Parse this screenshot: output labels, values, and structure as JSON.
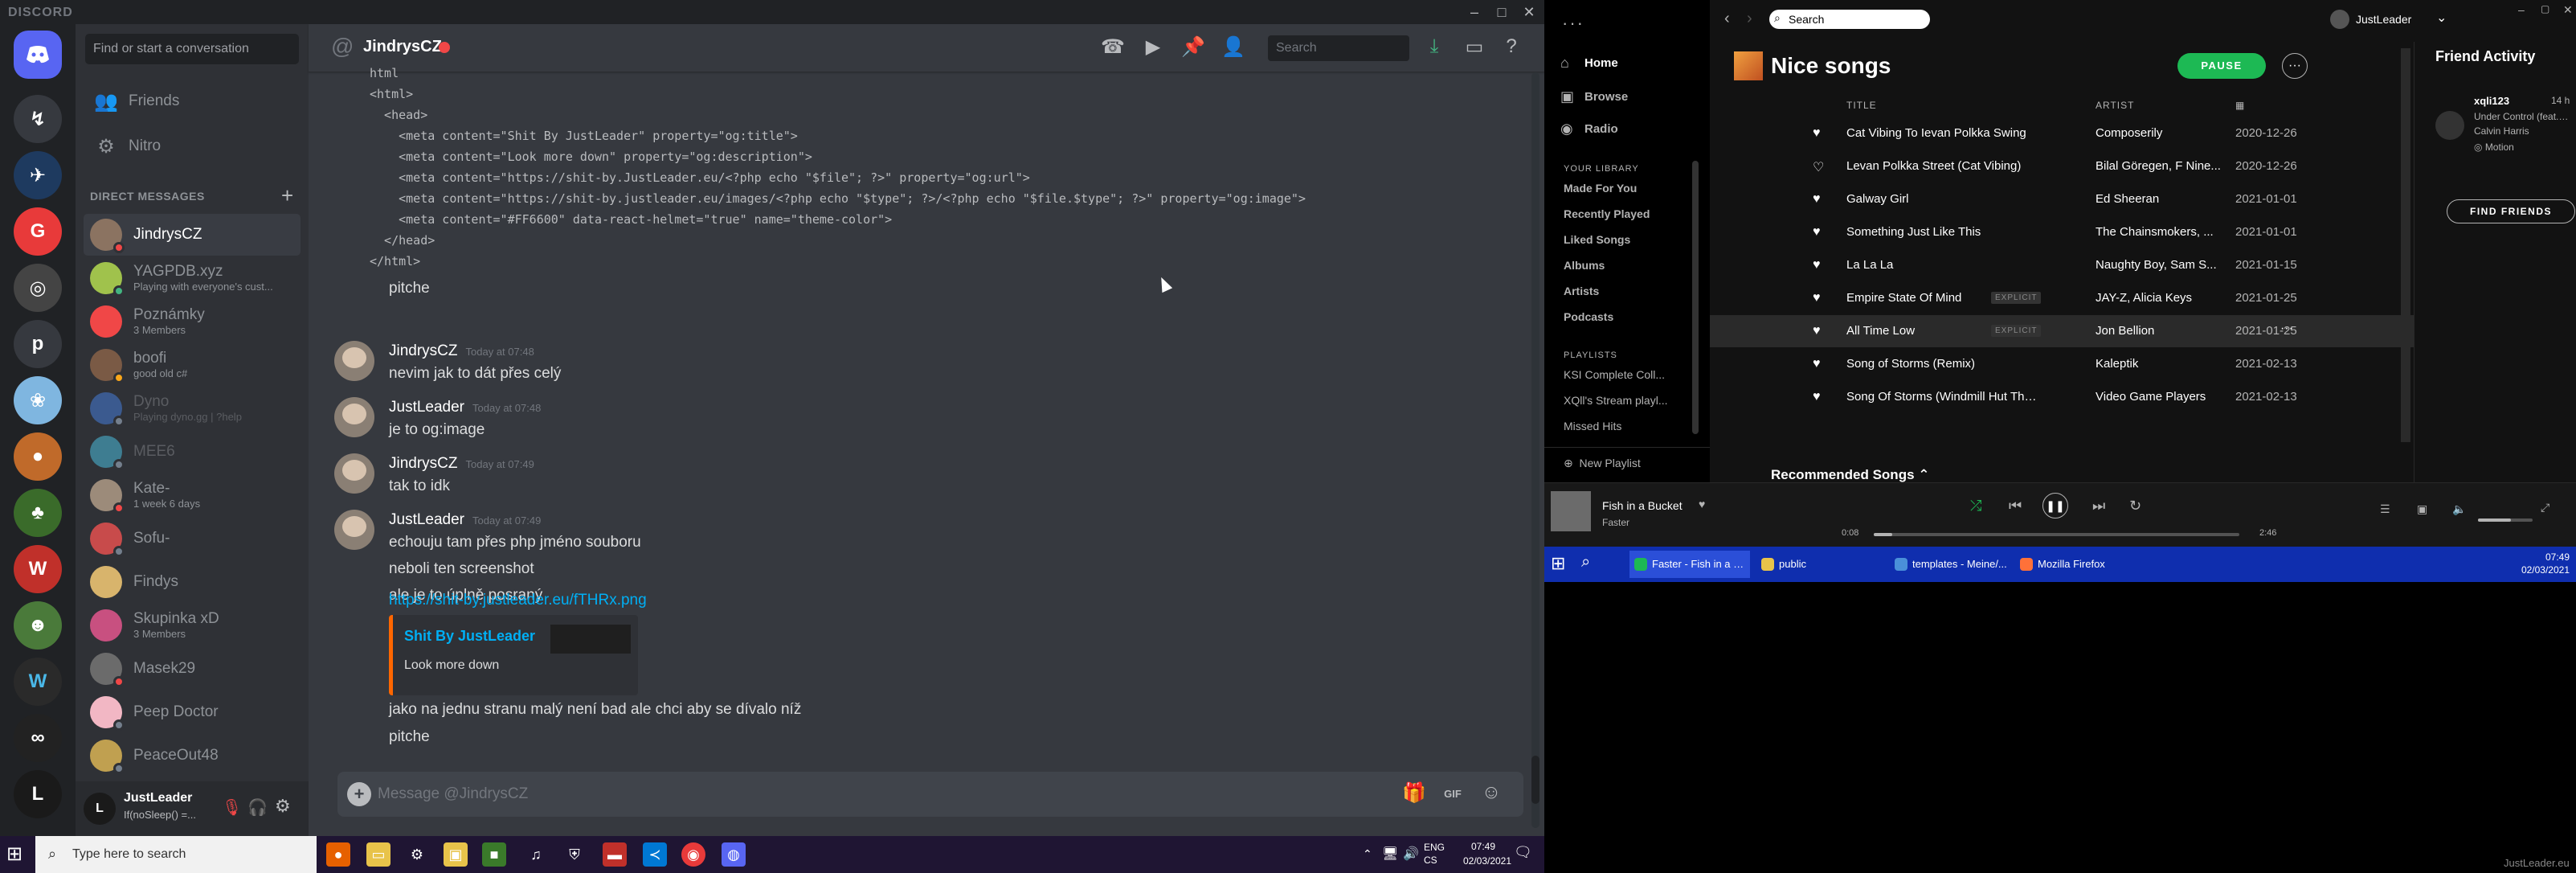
{
  "discord": {
    "brand": "DISCORD",
    "search_placeholder": "Find or start a conversation",
    "nav": {
      "friends": "Friends",
      "nitro": "Nitro"
    },
    "dm_header": "DIRECT MESSAGES",
    "dms": [
      {
        "name": "JindrysCZ",
        "sub": "",
        "color": "#8b7361",
        "status": "#f04747",
        "active": true
      },
      {
        "name": "YAGPDB.xyz",
        "sub": "Playing with everyone's cust...",
        "color": "#a0c24c",
        "status": "#43b581",
        "active": false
      },
      {
        "name": "Poznámky",
        "sub": "3 Members",
        "color": "#f04747",
        "status": "",
        "active": false
      },
      {
        "name": "boofi",
        "sub": "good old c#",
        "color": "#7a5a45",
        "status": "#faa61a",
        "active": false
      },
      {
        "name": "Dyno",
        "sub": "Playing dyno.gg | ?help",
        "color": "#3b5a8f",
        "status": "#747f8d",
        "active": false,
        "dim": true
      },
      {
        "name": "MEE6",
        "sub": "",
        "color": "#3e7d91",
        "status": "#747f8d",
        "active": false,
        "dim": true
      },
      {
        "name": "Kate-",
        "sub": "1 week 6 days",
        "color": "#9c8b7a",
        "status": "#f04747",
        "active": false
      },
      {
        "name": "Sofu-",
        "sub": "",
        "color": "#c84b4b",
        "status": "#747f8d",
        "active": false
      },
      {
        "name": "Findys",
        "sub": "",
        "color": "#d8b46c",
        "status": "",
        "active": false
      },
      {
        "name": "Skupinka xD",
        "sub": "3 Members",
        "color": "#c85080",
        "status": "",
        "active": false
      },
      {
        "name": "Masek29",
        "sub": "",
        "color": "#6b6b6b",
        "status": "#f04747",
        "active": false
      },
      {
        "name": "Peep Doctor",
        "sub": "",
        "color": "#f2b7c4",
        "status": "#747f8d",
        "active": false
      },
      {
        "name": "PeaceOut48",
        "sub": "",
        "color": "#c0a050",
        "status": "#747f8d",
        "active": false
      }
    ],
    "user": {
      "name": "JustLeader",
      "status": "If(noSleep() =..."
    },
    "channel": "JindrysCZ",
    "header_search": "Search",
    "code": [
      "html",
      "<html>",
      "  <head>",
      "    <meta content=\"Shit By JustLeader\" property=\"og:title\">",
      "    <meta content=\"Look more down\" property=\"og:description\">",
      "    <meta content=\"https://shit-by.JustLeader.eu/<?php echo \"$file\"; ?>\" property=\"og:url\">",
      "    <meta content=\"https://shit-by.justleader.eu/images/<?php echo \"$type\"; ?>/<?php echo \"$file.$type\"; ?>\" property=\"og:image\">",
      "    <meta content=\"#FF6600\" data-react-helmet=\"true\" name=\"theme-color\">",
      "  </head>",
      "</html>"
    ],
    "code_after": "pitche",
    "messages": [
      {
        "author": "JindrysCZ",
        "time": "Today at 07:48",
        "lines": [
          "nevim jak to dát přes celý"
        ]
      },
      {
        "author": "JustLeader",
        "time": "Today at 07:48",
        "lines": [
          "je to og:image"
        ]
      },
      {
        "author": "JindrysCZ",
        "time": "Today at 07:49",
        "lines": [
          "tak to idk"
        ]
      },
      {
        "author": "JustLeader",
        "time": "Today at 07:49",
        "lines": [
          "echouju tam přes php jméno souboru",
          "neboli ten screenshot",
          "ale je to úplně posraný"
        ]
      }
    ],
    "link": "https://shit-by.justleader.eu/fTHRx.png",
    "embed": {
      "title": "Shit By JustLeader",
      "desc": "Look more down"
    },
    "after_embed": [
      "jako na jednu stranu malý není bad ale chci aby se dívalo níž",
      "pitche"
    ],
    "composer_placeholder": "Message @JindrysCZ",
    "gif_label": "GIF"
  },
  "taskbar": {
    "search": "Type here to search",
    "lang": "ENG\nCS",
    "time": "07:49",
    "date": "02/03/2021"
  },
  "spotify": {
    "search": "Search",
    "user": "JustLeader",
    "nav": [
      "Home",
      "Browse",
      "Radio"
    ],
    "library_header": "YOUR LIBRARY",
    "library": [
      "Made For You",
      "Recently Played",
      "Liked Songs",
      "Albums",
      "Artists",
      "Podcasts"
    ],
    "playlists_header": "PLAYLISTS",
    "playlists": [
      "KSI Complete Coll...",
      "XQll's Stream playl...",
      "Missed Hits"
    ],
    "new_playlist": "New Playlist",
    "playlist_title": "Nice songs",
    "pause": "PAUSE",
    "cols": {
      "title": "TITLE",
      "artist": "ARTIST"
    },
    "tracks": [
      {
        "title": "Cat Vibing To Ievan Polkka Swing",
        "explicit": "",
        "artist": "Composerily",
        "date": "2020-12-26",
        "liked": true
      },
      {
        "title": "Levan Polkka Street (Cat Vibing)",
        "explicit": "",
        "artist": "Bilal Göregen, F Nine...",
        "date": "2020-12-26",
        "liked": false
      },
      {
        "title": "Galway Girl",
        "explicit": "",
        "artist": "Ed Sheeran",
        "date": "2021-01-01",
        "liked": true
      },
      {
        "title": "Something Just Like This",
        "explicit": "",
        "artist": "The Chainsmokers, ...",
        "date": "2021-01-01",
        "liked": true
      },
      {
        "title": "La La La",
        "explicit": "",
        "artist": "Naughty Boy, Sam S...",
        "date": "2021-01-15",
        "liked": true
      },
      {
        "title": "Empire State Of Mind",
        "explicit": "EXPLICIT",
        "artist": "JAY-Z, Alicia Keys",
        "date": "2021-01-25",
        "liked": true
      },
      {
        "title": "All Time Low",
        "explicit": "EXPLICIT",
        "artist": "Jon Bellion",
        "date": "2021-01-25",
        "liked": true,
        "selected": true
      },
      {
        "title": "Song of Storms (Remix)",
        "explicit": "",
        "artist": "Kaleptik",
        "date": "2021-02-13",
        "liked": true
      },
      {
        "title": "Song Of Storms (Windmill Hut Theme) [From...",
        "explicit": "",
        "artist": "Video Game Players",
        "date": "2021-02-13",
        "liked": true
      }
    ],
    "recommended": "Recommended Songs",
    "friends": {
      "title": "Friend Activity",
      "name": "xqli123",
      "time": "14 h",
      "track": "Under Control (feat. H...",
      "artist": "Calvin Harris",
      "context": "Motion",
      "find": "FIND FRIENDS"
    },
    "player": {
      "song": "Fish in a Bucket",
      "artist": "Faster",
      "elapsed": "0:08",
      "total": "2:46",
      "progress": 0.05,
      "volume": 0.6
    }
  },
  "taskbar2": {
    "items": [
      {
        "label": "Faster - Fish in a Bu...",
        "color": "#1db954"
      },
      {
        "label": "public",
        "color": "#e8c34a"
      },
      {
        "label": "templates - Meine/...",
        "color": "#4a90d9"
      },
      {
        "label": "Mozilla Firefox",
        "color": "#ff7139"
      }
    ],
    "time": "07:49",
    "date": "02/03/2021"
  },
  "watermark": "JustLeader.eu"
}
